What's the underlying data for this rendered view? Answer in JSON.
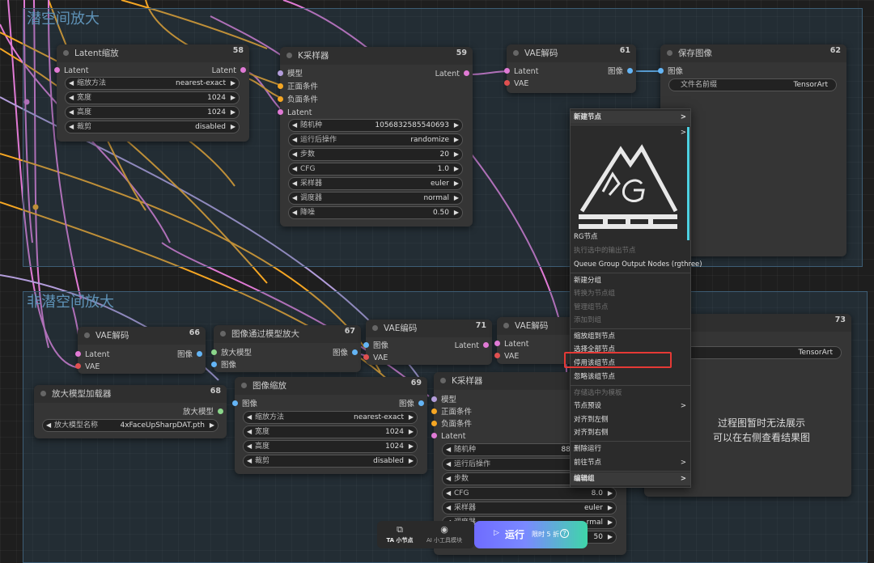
{
  "groups": {
    "latent_upscale": {
      "title": "潜空间放大"
    },
    "non_latent_upscale": {
      "title": "非潜空间放大"
    }
  },
  "nodes": {
    "n58": {
      "title": "Latent缩放",
      "id": "58",
      "input_label": "Latent",
      "output_label": "Latent",
      "widgets": [
        {
          "label": "缩放方法",
          "value": "nearest-exact"
        },
        {
          "label": "宽度",
          "value": "1024"
        },
        {
          "label": "高度",
          "value": "1024"
        },
        {
          "label": "裁剪",
          "value": "disabled"
        }
      ]
    },
    "n59": {
      "title": "K采样器",
      "id": "59",
      "inputs": [
        "模型",
        "正面条件",
        "负面条件",
        "Latent"
      ],
      "output_label": "Latent",
      "widgets": [
        {
          "label": "随机种",
          "value": "1056832585540693"
        },
        {
          "label": "运行后操作",
          "value": "randomize"
        },
        {
          "label": "步数",
          "value": "20"
        },
        {
          "label": "CFG",
          "value": "1.0"
        },
        {
          "label": "采样器",
          "value": "euler"
        },
        {
          "label": "调度器",
          "value": "normal"
        },
        {
          "label": "降噪",
          "value": "0.50"
        }
      ]
    },
    "n61": {
      "title": "VAE解码",
      "id": "61",
      "inputs": [
        "Latent",
        "VAE"
      ],
      "output_label": "图像"
    },
    "n62": {
      "title": "保存图像",
      "id": "62",
      "input_label": "图像",
      "widget": {
        "label": "文件名前缀",
        "value": "TensorArt"
      }
    },
    "n66": {
      "title": "VAE解码",
      "id": "66",
      "inputs": [
        "Latent",
        "VAE"
      ],
      "output_label": "图像"
    },
    "n67": {
      "title": "图像通过模型放大",
      "id": "67",
      "inputs": [
        "放大模型",
        "图像"
      ],
      "output_label": "图像"
    },
    "n71": {
      "title": "VAE编码",
      "id": "71",
      "inputs": [
        "图像",
        "VAE"
      ],
      "output_label": "Latent"
    },
    "nvae2": {
      "title": "VAE解码",
      "inputs": [
        "Latent",
        "VAE"
      ]
    },
    "n73": {
      "id": "73",
      "widget_value": "TensorArt",
      "preview_line1": "过程图暂时无法展示",
      "preview_line2": "可以在右侧查看结果图"
    },
    "n68": {
      "title": "放大模型加载器",
      "id": "68",
      "output_label": "放大模型",
      "widget": {
        "label": "放大模型名称",
        "value": "4xFaceUpSharpDAT.pth"
      }
    },
    "n69": {
      "title": "图像缩放",
      "id": "69",
      "input_label": "图像",
      "output_label": "图像",
      "widgets": [
        {
          "label": "缩放方法",
          "value": "nearest-exact"
        },
        {
          "label": "宽度",
          "value": "1024"
        },
        {
          "label": "高度",
          "value": "1024"
        },
        {
          "label": "裁剪",
          "value": "disabled"
        }
      ]
    },
    "nks2": {
      "title": "K采样器",
      "inputs": [
        "模型",
        "正面条件",
        "负面条件",
        "Latent"
      ],
      "widgets": [
        {
          "label": "随机种",
          "value": "885892537"
        },
        {
          "label": "运行后操作",
          "value": "ran"
        },
        {
          "label": "步数",
          "value": ""
        },
        {
          "label": "CFG",
          "value": "8.0"
        },
        {
          "label": "采样器",
          "value": "euler"
        },
        {
          "label": "调度器",
          "value": "rmal"
        },
        {
          "label": "",
          "value": "50"
        }
      ]
    }
  },
  "context_menu": {
    "items": [
      {
        "label": "新建节点",
        "arrow": ">"
      },
      {
        "label": "",
        "arrow": ">"
      },
      {
        "label": "RG节点"
      },
      {
        "label": "执行选中的输出节点"
      },
      {
        "label": "Queue Group Output Nodes (rgthree)"
      },
      {
        "label": "新建分组"
      },
      {
        "label": "转换为节点组"
      },
      {
        "label": "管理组节点"
      },
      {
        "label": "添加到组"
      },
      {
        "label": "缩放组到节点"
      },
      {
        "label": "选择全部节点"
      },
      {
        "label": "停用该组节点"
      },
      {
        "label": "忽略该组节点"
      },
      {
        "label": "存储选中为模板"
      },
      {
        "label": "节点预设",
        "arrow": ">"
      },
      {
        "label": "对齐到左侧"
      },
      {
        "label": "对齐到右侧"
      },
      {
        "label": "删除运行"
      },
      {
        "label": "前往节点",
        "arrow": ">"
      },
      {
        "label": "编辑组",
        "arrow": ">"
      }
    ],
    "highlight_color": "#e53935"
  },
  "toolbar": {
    "ta_nodes_label": "TA 小节点",
    "ai_tools_label": "AI 小工具模块",
    "run_label": "运行",
    "promo_label": "限时 5 折"
  },
  "colors": {
    "accent_pink": "#e07ad5",
    "accent_orange": "#f5a623",
    "accent_blue": "#64b5f6",
    "accent_lavender": "#b39ddb",
    "group_border": "#3d5d74"
  }
}
